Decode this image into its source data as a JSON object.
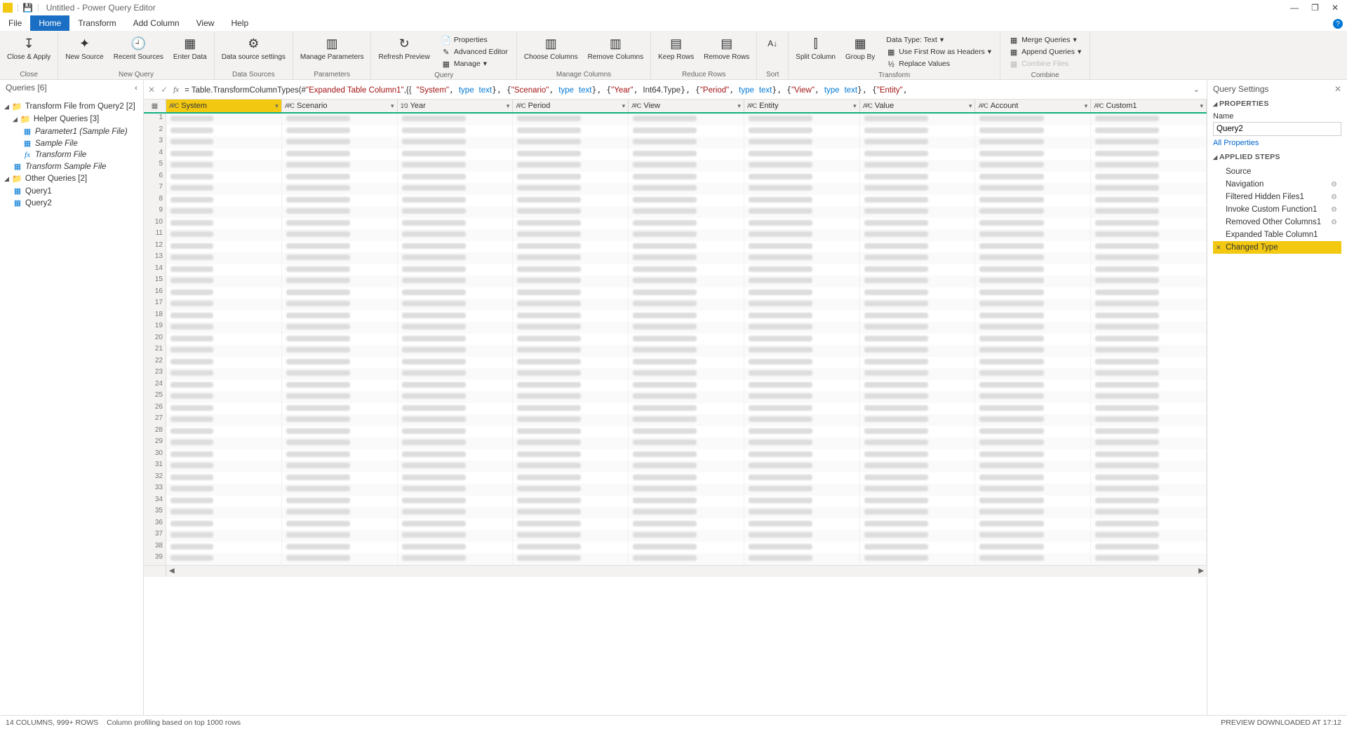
{
  "titlebar": {
    "title": "Untitled - Power Query Editor"
  },
  "tabs": {
    "items": [
      "File",
      "Home",
      "Transform",
      "Add Column",
      "View",
      "Help"
    ],
    "active": 1
  },
  "ribbon": {
    "close": {
      "closeApply": "Close &\nApply",
      "group": "Close"
    },
    "newquery": {
      "newSource": "New\nSource",
      "recent": "Recent\nSources",
      "enter": "Enter\nData",
      "group": "New Query"
    },
    "datasources": {
      "btn": "Data source\nsettings",
      "group": "Data Sources"
    },
    "parameters": {
      "btn": "Manage\nParameters",
      "group": "Parameters"
    },
    "query": {
      "refresh": "Refresh\nPreview",
      "properties": "Properties",
      "advEditor": "Advanced Editor",
      "manage": "Manage",
      "group": "Query"
    },
    "manageCols": {
      "choose": "Choose\nColumns",
      "remove": "Remove\nColumns",
      "group": "Manage Columns"
    },
    "reduce": {
      "keep": "Keep\nRows",
      "remove": "Remove\nRows",
      "group": "Reduce Rows"
    },
    "sort": {
      "group": "Sort"
    },
    "transform": {
      "split": "Split\nColumn",
      "group_btn": "Group\nBy",
      "dataType": "Data Type: Text",
      "firstRow": "Use First Row as Headers",
      "replace": "Replace Values",
      "group": "Transform"
    },
    "combine": {
      "merge": "Merge Queries",
      "append": "Append Queries",
      "files": "Combine Files",
      "group": "Combine"
    }
  },
  "queriesPane": {
    "title": "Queries [6]",
    "tree": {
      "root": "Transform File from Query2 [2]",
      "helper": "Helper Queries [3]",
      "param": "Parameter1 (Sample File)",
      "sample": "Sample File",
      "tfile": "Transform File",
      "tsfile": "Transform Sample File",
      "other": "Other Queries [2]",
      "q1": "Query1",
      "q2": "Query2"
    }
  },
  "formula": {
    "prefix": "= Table.TransformColumnTypes(#",
    "exp": "\"Expanded Table Column1\"",
    "p1": ",{{",
    "s_sys": "\"System\"",
    "s_scn": "\"Scenario\"",
    "s_yr": "\"Year\"",
    "s_per": "\"Period\"",
    "s_view": "\"View\"",
    "s_ent": "\"Entity\"",
    "t_txt": "type",
    "t_txtw": "text",
    "int": "Int64.Type"
  },
  "columns": [
    "System",
    "Scenario",
    "Year",
    "Period",
    "View",
    "Entity",
    "Value",
    "Account",
    "Custom1"
  ],
  "rowCount": 39,
  "settings": {
    "title": "Query Settings",
    "propHead": "PROPERTIES",
    "nameLabel": "Name",
    "nameValue": "Query2",
    "allProps": "All Properties",
    "stepsHead": "APPLIED STEPS",
    "steps": [
      {
        "label": "Source",
        "gear": false
      },
      {
        "label": "Navigation",
        "gear": true
      },
      {
        "label": "Filtered Hidden Files1",
        "gear": true
      },
      {
        "label": "Invoke Custom Function1",
        "gear": true
      },
      {
        "label": "Removed Other Columns1",
        "gear": true
      },
      {
        "label": "Expanded Table Column1",
        "gear": false
      },
      {
        "label": "Changed Type",
        "gear": false,
        "sel": true
      }
    ]
  },
  "status": {
    "left1": "14 COLUMNS, 999+ ROWS",
    "left2": "Column profiling based on top 1000 rows",
    "right": "PREVIEW DOWNLOADED AT 17:12"
  }
}
